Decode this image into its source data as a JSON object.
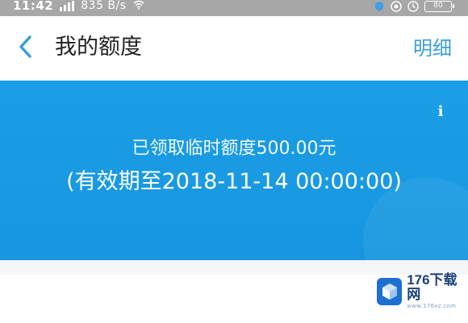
{
  "status_bar": {
    "time": "11:42",
    "network_speed": "835 B/s",
    "battery_text": "80"
  },
  "header": {
    "title": "我的额度",
    "detail_label": "明细"
  },
  "banner": {
    "quota_text": "已领取临时额度500.00元",
    "validity_text": "(有效期至2018-11-14 00:00:00)",
    "info_symbol": "i"
  },
  "watermark": {
    "main_text": "176下载网",
    "sub_text": "www.176xz.com"
  },
  "icons": {
    "back": "chevron-left-icon",
    "info": "info-icon"
  },
  "colors": {
    "accent": "#3a9fd6",
    "banner": "#1a9ee6",
    "status_bar": "#a7a7a7"
  }
}
